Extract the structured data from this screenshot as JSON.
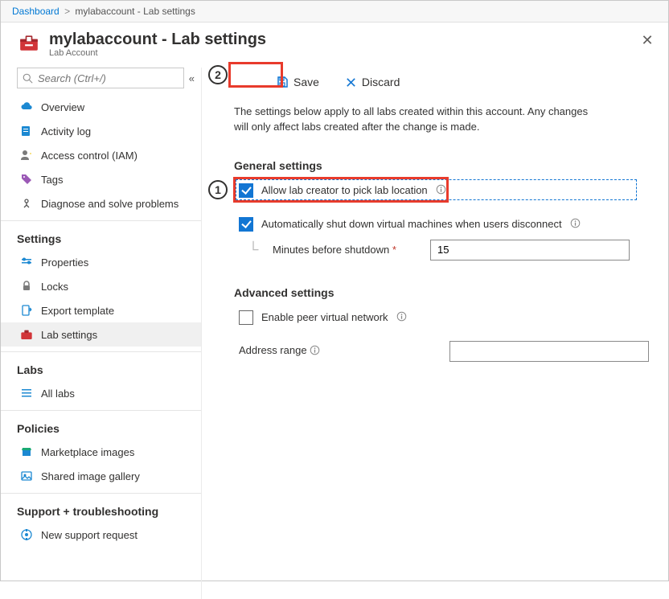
{
  "breadcrumb": {
    "root": "Dashboard",
    "current": "mylabaccount - Lab settings"
  },
  "header": {
    "title": "mylabaccount - Lab settings",
    "subtitle": "Lab Account"
  },
  "search": {
    "placeholder": "Search (Ctrl+/)"
  },
  "nav": {
    "overview": "Overview",
    "activity": "Activity log",
    "iam": "Access control (IAM)",
    "tags": "Tags",
    "diagnose": "Diagnose and solve problems",
    "sec_settings": "Settings",
    "properties": "Properties",
    "locks": "Locks",
    "export": "Export template",
    "labsettings": "Lab settings",
    "sec_labs": "Labs",
    "alllabs": "All labs",
    "sec_policies": "Policies",
    "marketplace": "Marketplace images",
    "sharedgallery": "Shared image gallery",
    "sec_support": "Support + troubleshooting",
    "newrequest": "New support request"
  },
  "toolbar": {
    "save": "Save",
    "discard": "Discard"
  },
  "callouts": {
    "one": "1",
    "two": "2"
  },
  "main": {
    "intro": "The settings below apply to all labs created within this account. Any changes will only affect labs created after the change is made.",
    "general_h": "General settings",
    "allow_location": "Allow lab creator to pick lab location",
    "auto_shutdown": "Automatically shut down virtual machines when users disconnect",
    "minutes_label": "Minutes before shutdown",
    "minutes_value": "15",
    "advanced_h": "Advanced settings",
    "enable_peer": "Enable peer virtual network",
    "address_range": "Address range"
  }
}
